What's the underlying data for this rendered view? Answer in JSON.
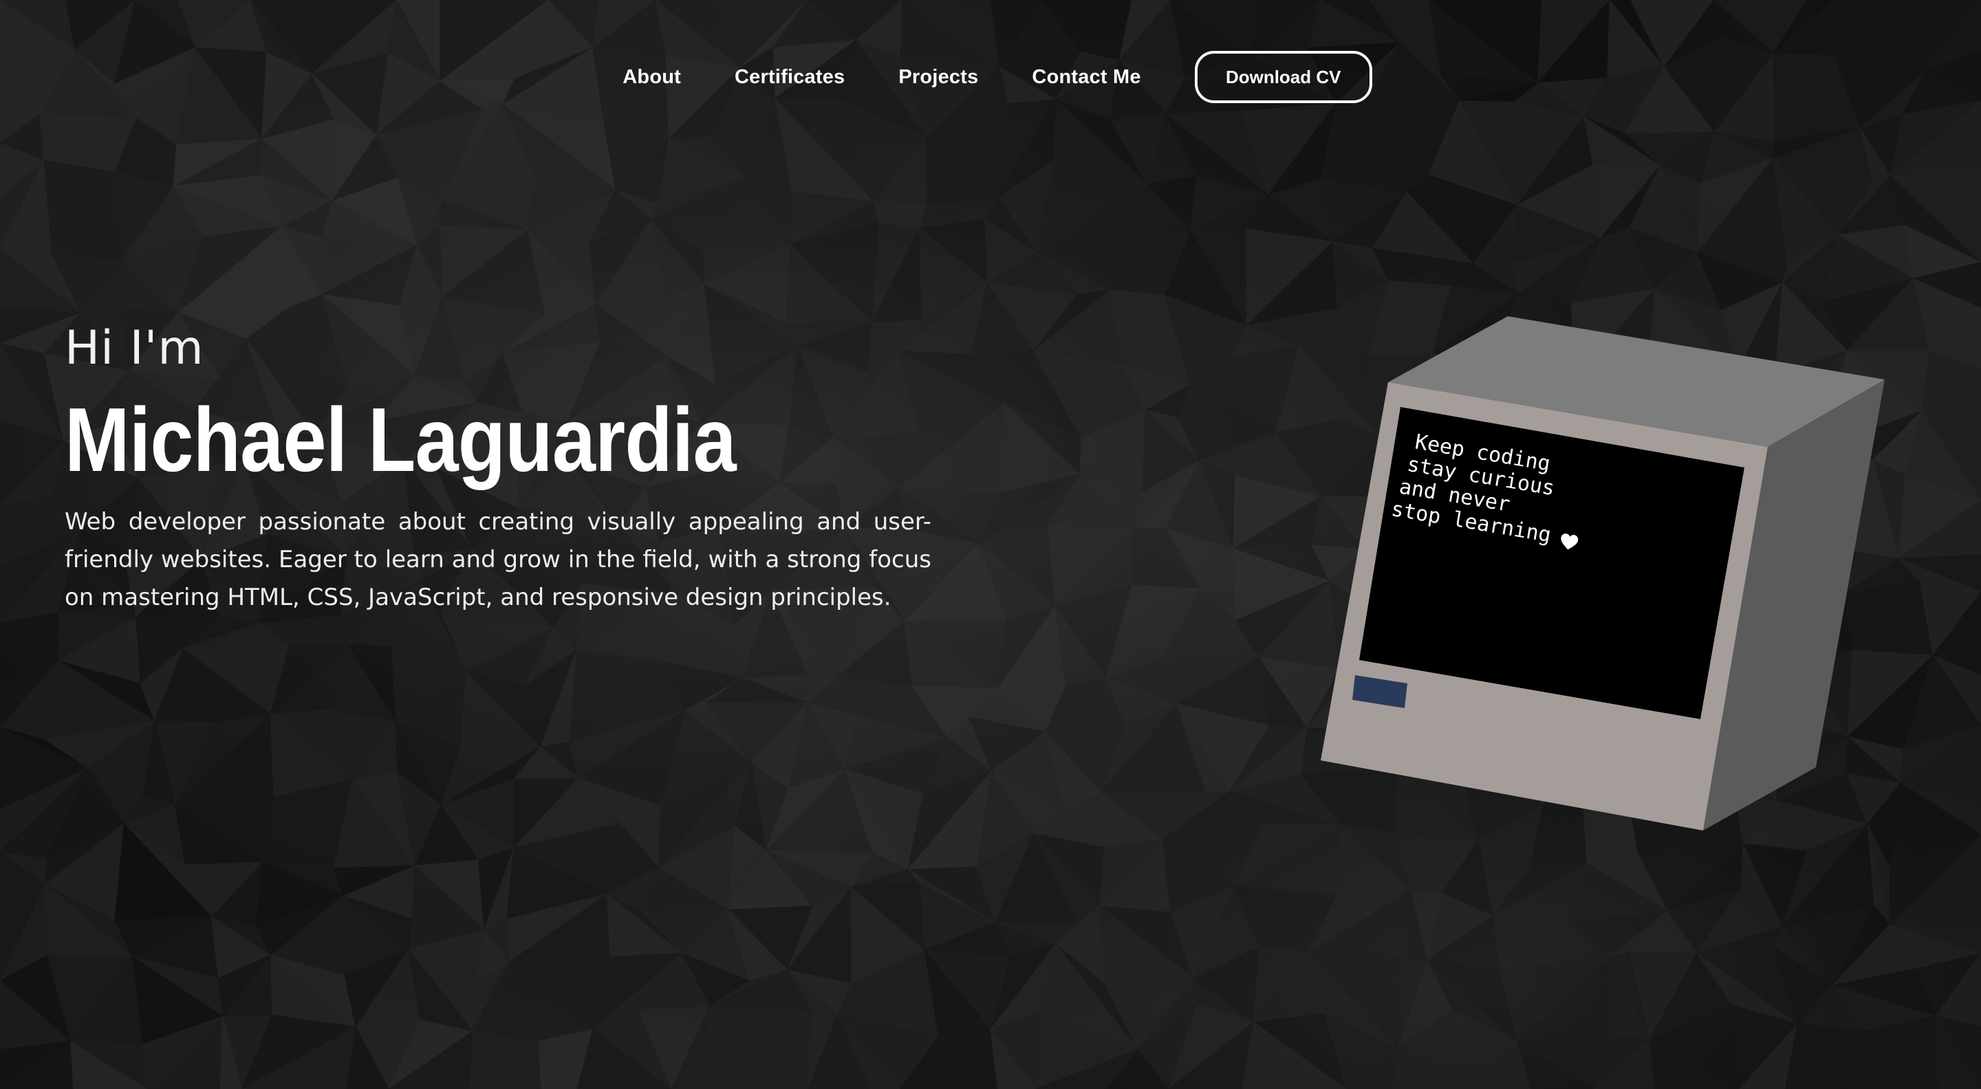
{
  "nav": {
    "links": [
      "About",
      "Certificates",
      "Projects",
      "Contact Me"
    ],
    "cv_button": "Download CV"
  },
  "hero": {
    "greeting": "Hi I'm",
    "name": "Michael Laguardia",
    "bio": "Web developer passionate about creating visually appealing and user-friendly websites. Eager to learn and grow in the field, with a strong focus on mastering HTML, CSS, JavaScript, and responsive design principles."
  },
  "computer": {
    "screen_lines": [
      "Keep coding",
      "stay curious",
      "and never",
      "stop learning"
    ],
    "heart_icon": "heart-icon"
  },
  "colors": {
    "background": "#141414",
    "text": "#ffffff",
    "monitor_front": "#a59d99",
    "monitor_top": "#7f7f7f",
    "monitor_side": "#5d5d5d",
    "screen": "#000000",
    "drive_slot": "#2a3a5c"
  }
}
